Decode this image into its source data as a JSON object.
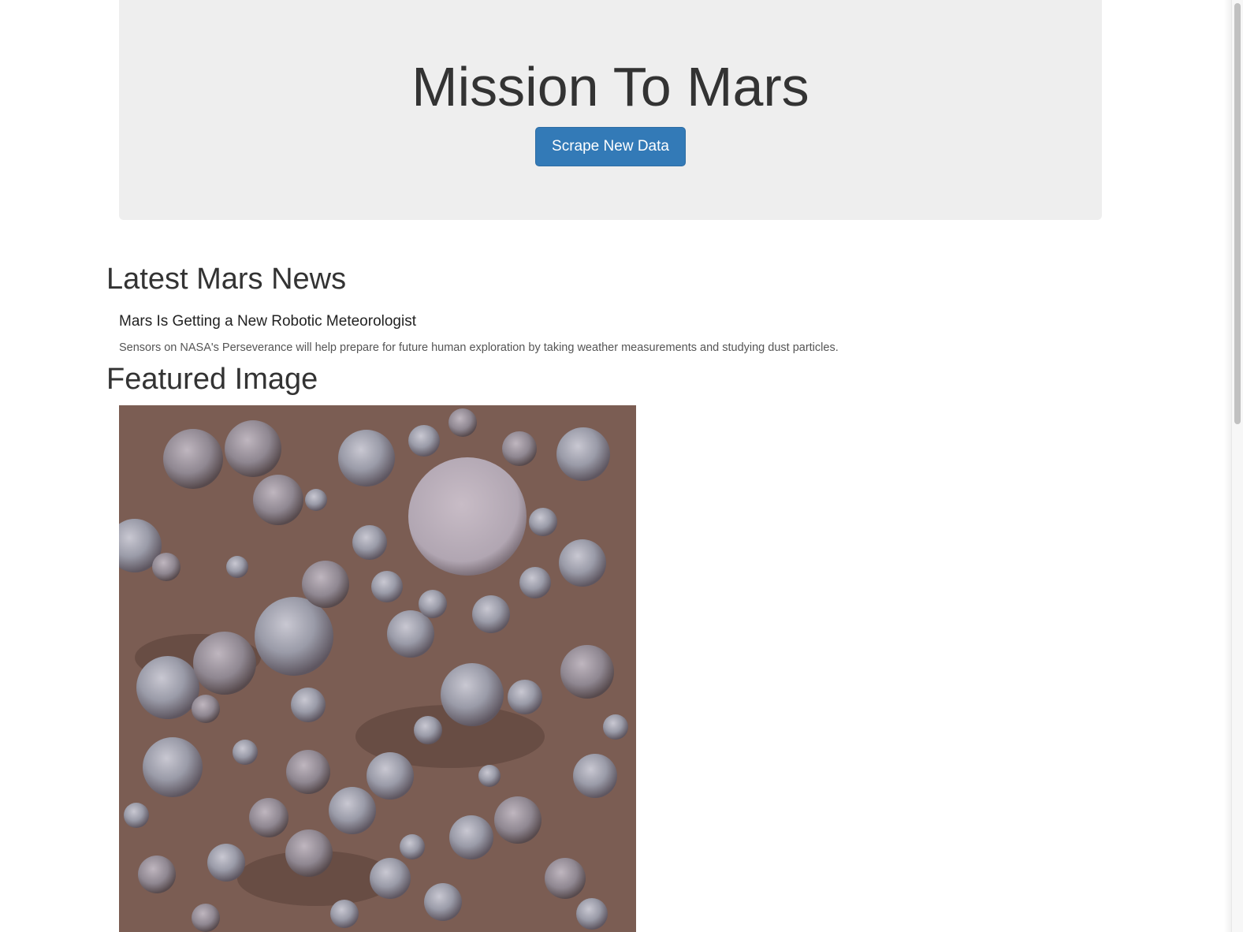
{
  "header": {
    "title": "Mission To Mars",
    "scrape_button_label": "Scrape New Data"
  },
  "news": {
    "heading": "Latest Mars News",
    "title": "Mars Is Getting a New Robotic Meteorologist",
    "teaser": "Sensors on NASA's Perseverance will help prepare for future human exploration by taking weather measurements and studying dust particles."
  },
  "featured": {
    "heading": "Featured Image"
  },
  "colors": {
    "jumbotron_background": "#eeeeee",
    "primary_button": "#337ab7",
    "text": "#333333"
  }
}
